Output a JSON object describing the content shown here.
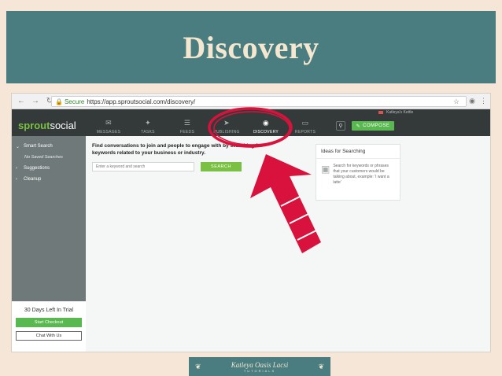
{
  "slide": {
    "title": "Discovery"
  },
  "browser": {
    "secure_label": "Secure",
    "url": "https://app.sproutsocial.com/discovery/"
  },
  "app": {
    "logo_part1": "sprout",
    "logo_part2": "social",
    "user_label": "Katleya's Kettle",
    "nav": [
      {
        "label": "MESSAGES",
        "icon": "envelope-icon"
      },
      {
        "label": "TASKS",
        "icon": "pin-icon"
      },
      {
        "label": "FEEDS",
        "icon": "list-icon"
      },
      {
        "label": "PUBLISHING",
        "icon": "send-icon"
      },
      {
        "label": "DISCOVERY",
        "icon": "compass-icon",
        "active": true
      },
      {
        "label": "REPORTS",
        "icon": "bar-chart-icon"
      }
    ],
    "compose_label": "COMPOSE"
  },
  "sidebar": {
    "items": [
      {
        "label": "Smart Search"
      },
      {
        "sub": "No Saved Searches"
      },
      {
        "label": "Suggestions"
      },
      {
        "label": "Cleanup"
      }
    ],
    "trial_text": "30 Days Left In Trial",
    "checkout_label": "Start Checkout",
    "chat_label": "Chat With Us"
  },
  "main": {
    "headline": "Find conversations to join and people to engage with by searching for keywords related to your business or industry.",
    "input_placeholder": "Enter a keyword and search",
    "search_label": "SEARCH",
    "ideas_title": "Ideas for Searching",
    "ideas_text": "Search for keywords or phrases that your customers would be talking about, example: 'I want a latte'"
  },
  "footer": {
    "name": "Katleya Oasis Lacsi",
    "sub": "TUTORIALS"
  },
  "colors": {
    "banner": "#4a7d80",
    "annotation": "#d8123c",
    "accent_green": "#59b84f"
  }
}
